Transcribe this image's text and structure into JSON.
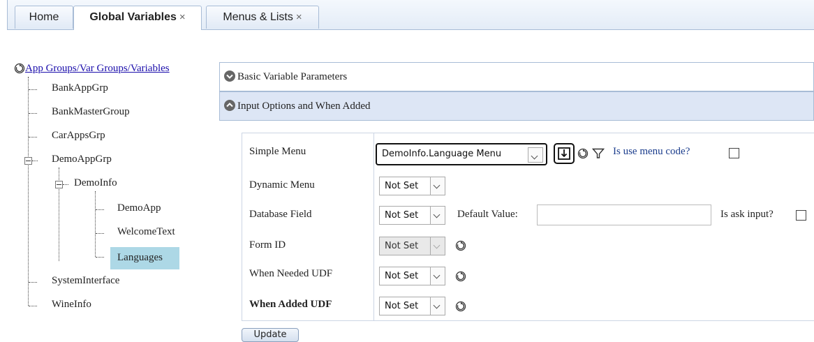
{
  "tabs": [
    {
      "label": "Home",
      "active": false,
      "closable": false
    },
    {
      "label": "Global Variables",
      "active": true,
      "closable": true
    },
    {
      "label": "Menus & Lists",
      "active": false,
      "closable": true
    }
  ],
  "tab_close_glyph": "×",
  "tree": {
    "root_label": "App Groups/Var Groups/Variables",
    "root_icon": "refresh-icon",
    "items": [
      {
        "label": "BankAppGrp",
        "level": 1
      },
      {
        "label": "BankMasterGroup",
        "level": 1
      },
      {
        "label": "CarAppsGrp",
        "level": 1
      },
      {
        "label": "DemoAppGrp",
        "level": 1,
        "expanded": true
      },
      {
        "label": "DemoInfo",
        "level": 2,
        "expanded": true
      },
      {
        "label": "DemoApp",
        "level": 3
      },
      {
        "label": "WelcomeText",
        "level": 3
      },
      {
        "label": "Languages",
        "level": 3,
        "selected": true
      },
      {
        "label": "SystemInterface",
        "level": 1
      },
      {
        "label": "WineInfo",
        "level": 1
      }
    ]
  },
  "sections": {
    "basic": {
      "label": "Basic Variable Parameters",
      "expanded": false
    },
    "input_options": {
      "label": "Input Options and When Added",
      "expanded": true
    }
  },
  "form": {
    "simple_menu": {
      "label": "Simple Menu",
      "value": "DemoInfo.Language Menu",
      "use_menu_code_label": "Is use menu code?",
      "use_menu_code": false
    },
    "dynamic_menu": {
      "label": "Dynamic Menu",
      "value": "Not Set"
    },
    "database_field": {
      "label": "Database Field",
      "value": "Not Set",
      "default_value_label": "Default Value:",
      "default_value": "",
      "ask_input_label": "Is ask input?",
      "ask_input": false
    },
    "form_id": {
      "label": "Form ID",
      "value": "Not Set",
      "disabled": true
    },
    "when_needed_udf": {
      "label": "When Needed UDF",
      "value": "Not Set"
    },
    "when_added_udf": {
      "label": "When Added UDF",
      "value": "Not Set",
      "bold": true
    }
  },
  "update_label": "Update",
  "colors": {
    "selected_bg": "#add8e6",
    "section_open_bg": "#dde6f5",
    "border": "#a8bcd6",
    "link": "#1a0dab"
  }
}
